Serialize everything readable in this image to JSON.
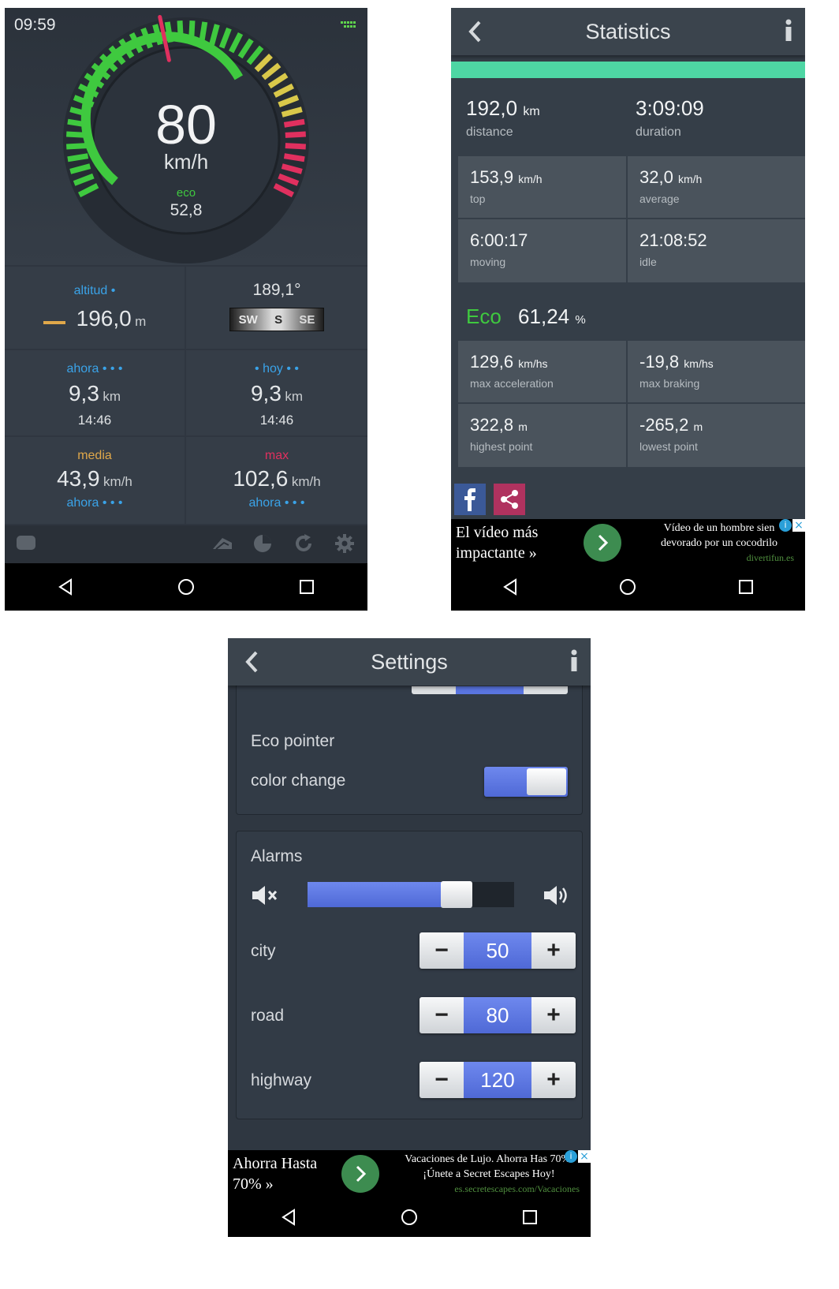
{
  "speedometer": {
    "clock": "09:59",
    "speed": "80",
    "speed_unit": "km/h",
    "eco_label": "eco",
    "eco_value": "52,8",
    "altitude_label": "altitud",
    "altitude_value": "196,0",
    "altitude_unit": "m",
    "heading_value": "189,1°",
    "compass": [
      "SW",
      "S",
      "SE"
    ],
    "now_label": "ahora",
    "now_distance": "9,3",
    "now_unit": "km",
    "now_time": "14:46",
    "today_label": "hoy",
    "today_distance": "9,3",
    "today_unit": "km",
    "today_time": "14:46",
    "avg_label": "media",
    "avg_value": "43,9",
    "avg_unit": "km/h",
    "avg_sub": "ahora",
    "max_label": "max",
    "max_value": "102,6",
    "max_unit": "km/h",
    "max_sub": "ahora",
    "colors": {
      "green": "#3fc93f",
      "yellow": "#d9c84a",
      "red": "#e0305f",
      "blue": "#3aa3e8",
      "orange": "#e0a84a"
    }
  },
  "statistics": {
    "title": "Statistics",
    "distance_value": "192,0",
    "distance_unit": "km",
    "distance_label": "distance",
    "duration_value": "3:09:09",
    "duration_label": "duration",
    "top_value": "153,9",
    "top_unit": "km/h",
    "top_label": "top",
    "average_value": "32,0",
    "average_unit": "km/h",
    "average_label": "average",
    "moving_value": "6:00:17",
    "moving_label": "moving",
    "idle_value": "21:08:52",
    "idle_label": "idle",
    "eco_label": "Eco",
    "eco_value": "61,24",
    "eco_unit": "%",
    "max_acc_value": "129,6",
    "max_acc_unit": "km/hs",
    "max_acc_label": "max acceleration",
    "max_brk_value": "-19,8",
    "max_brk_unit": "km/hs",
    "max_brk_label": "max braking",
    "highest_value": "322,8",
    "highest_unit": "m",
    "highest_label": "highest point",
    "lowest_value": "-265,2",
    "lowest_unit": "m",
    "lowest_label": "lowest point",
    "ad_left": "El vídeo más impactante »",
    "ad_right": "Vídeo de un hombre sien devorado por un cocodrilo",
    "ad_source": "divertifun.es"
  },
  "settings": {
    "title": "Settings",
    "eco_pointer_label": "Eco pointer",
    "color_change_label": "color change",
    "color_change_on": true,
    "alarms_label": "Alarms",
    "volume_level": 0.72,
    "city_label": "city",
    "city_value": "50",
    "road_label": "road",
    "road_value": "80",
    "highway_label": "highway",
    "highway_value": "120",
    "minus": "−",
    "plus": "+",
    "ad_left": "Ahorra Hasta 70% »",
    "ad_right": "Vacaciones de Lujo. Ahorra Has 70%. ¡Únete a Secret Escapes Hoy!",
    "ad_source": "es.secretescapes.com/Vacaciones"
  }
}
